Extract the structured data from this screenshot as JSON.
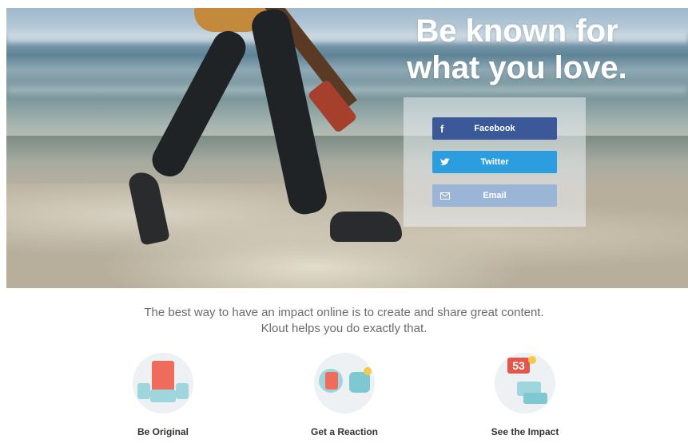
{
  "hero": {
    "headline_line1": "Be known for",
    "headline_line2": "what you love."
  },
  "signup": {
    "facebook_label": "Facebook",
    "twitter_label": "Twitter",
    "email_label": "Email",
    "facebook_icon": "f",
    "colors": {
      "facebook": "#3b5998",
      "twitter": "#2c9ee0",
      "email": "#9bb5d6"
    }
  },
  "tagline": {
    "line1": "The best way to have an impact online is to create and share great content.",
    "line2": "Klout helps you do exactly that."
  },
  "features": [
    {
      "label": "Be Original",
      "icon": "document-icon"
    },
    {
      "label": "Get a Reaction",
      "icon": "chat-documents-icon"
    },
    {
      "label": "See the Impact",
      "icon": "score-badge-icon",
      "badge_value": "53"
    }
  ]
}
